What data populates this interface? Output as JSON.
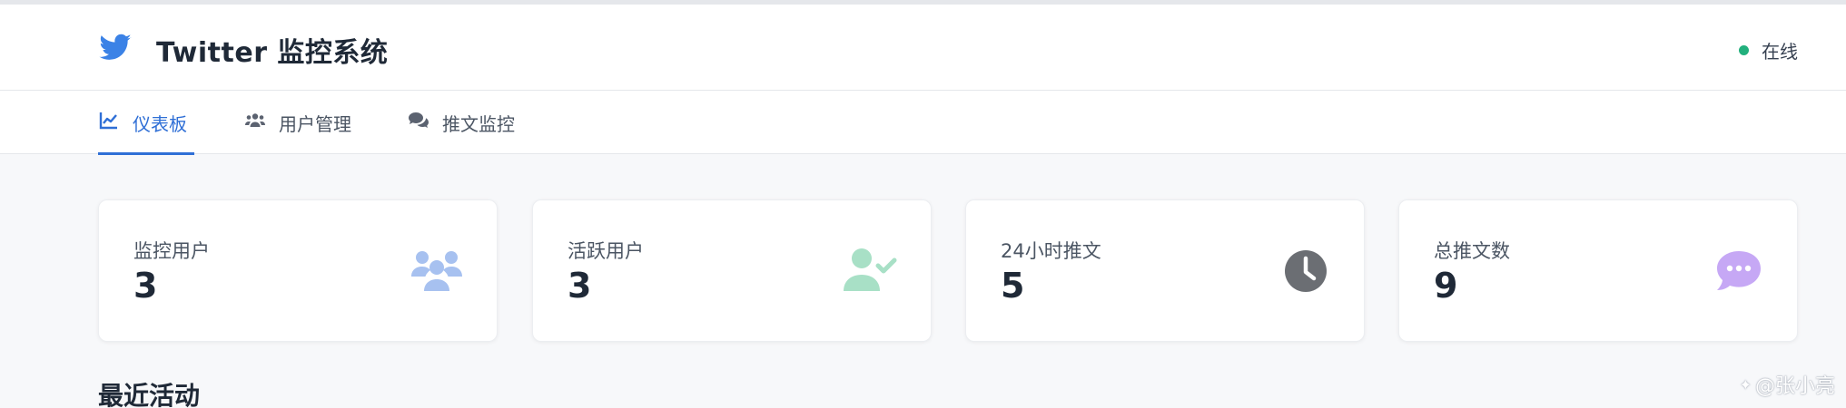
{
  "header": {
    "title": "Twitter 监控系统",
    "logo_icon": "twitter-bird-icon",
    "status_label": "在线",
    "status_color": "#22b07d"
  },
  "nav": {
    "tabs": [
      {
        "label": "仪表板",
        "icon": "chart-line-icon",
        "active": true
      },
      {
        "label": "用户管理",
        "icon": "users-icon",
        "active": false
      },
      {
        "label": "推文监控",
        "icon": "comments-icon",
        "active": false
      }
    ]
  },
  "stats": [
    {
      "label": "监控用户",
      "value": "3",
      "icon": "users-icon",
      "color": "#a7c1f0"
    },
    {
      "label": "活跃用户",
      "value": "3",
      "icon": "user-check-icon",
      "color": "#a8e0c6"
    },
    {
      "label": "24小时推文",
      "value": "5",
      "icon": "clock-icon",
      "color": "#6b6e73"
    },
    {
      "label": "总推文数",
      "value": "9",
      "icon": "comment-dots-icon",
      "color": "#c6a8f5"
    }
  ],
  "section": {
    "title": "最近活动"
  },
  "watermark": {
    "text": "@张小亮"
  },
  "colors": {
    "accent": "#2f6fd6",
    "twitter": "#3b82e6"
  }
}
